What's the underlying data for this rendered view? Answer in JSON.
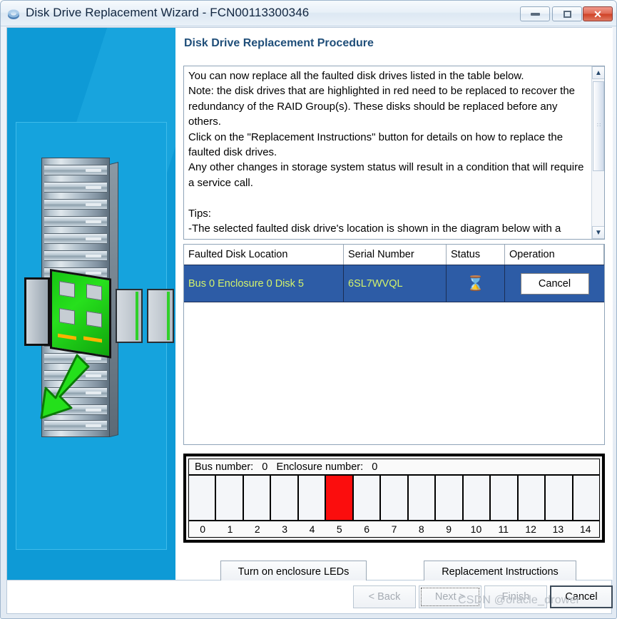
{
  "window": {
    "title": "Disk Drive Replacement Wizard - FCN00113300346",
    "app_icon": "disk-wizard-icon",
    "controls": {
      "minimize": "minimize-icon",
      "maximize": "maximize-icon",
      "close": "✕"
    }
  },
  "procedure": {
    "heading": "Disk Drive Replacement Procedure",
    "instructions": "You can now replace all the faulted disk drives listed in the table below.\nNote: the disk drives that are highlighted in red need to be replaced to recover the redundancy of the RAID Group(s). These disks should be replaced before any others.\nClick on the \"Replacement Instructions\" button for details on how to replace the faulted disk drives.\nAny other changes in storage system status will result in a condition that will require a service call.\n\nTips:\n-The selected faulted disk drive's location is shown in the diagram below with a"
  },
  "scrollbar": {
    "up_arrow": "▲",
    "down_arrow": "▼",
    "grip": "∷"
  },
  "table": {
    "columns": [
      "Faulted Disk Location",
      "Serial Number",
      "Status",
      "Operation"
    ],
    "rows": [
      {
        "location": "Bus 0 Enclosure 0 Disk 5",
        "serial": "6SL7WVQL",
        "status_icon": "⌛",
        "operation_label": "Cancel"
      }
    ]
  },
  "enclosure": {
    "header": "Bus number:   0   Enclosure number:   0",
    "bus_number": "0",
    "enclosure_number": "0",
    "slot_labels": [
      "0",
      "1",
      "2",
      "3",
      "4",
      "5",
      "6",
      "7",
      "8",
      "9",
      "10",
      "11",
      "12",
      "13",
      "14"
    ],
    "faulted_slot": 5,
    "faulted_color": "#fb0d0d"
  },
  "actions": {
    "leds_label": "Turn on enclosure LEDs",
    "instructions_label": "Replacement Instructions"
  },
  "footer": {
    "back_label": "< Back",
    "next_label": "Next >",
    "finish_label": "Finish",
    "cancel_label": "Cancel"
  },
  "watermark": "CSDN @oracle_drower",
  "colors": {
    "panel_blue": "#0e9ad6",
    "heading_blue": "#1f4e79",
    "row_blue": "#2d5ca6",
    "row_text": "#d3f36b",
    "fault_red": "#fb0d0d"
  }
}
